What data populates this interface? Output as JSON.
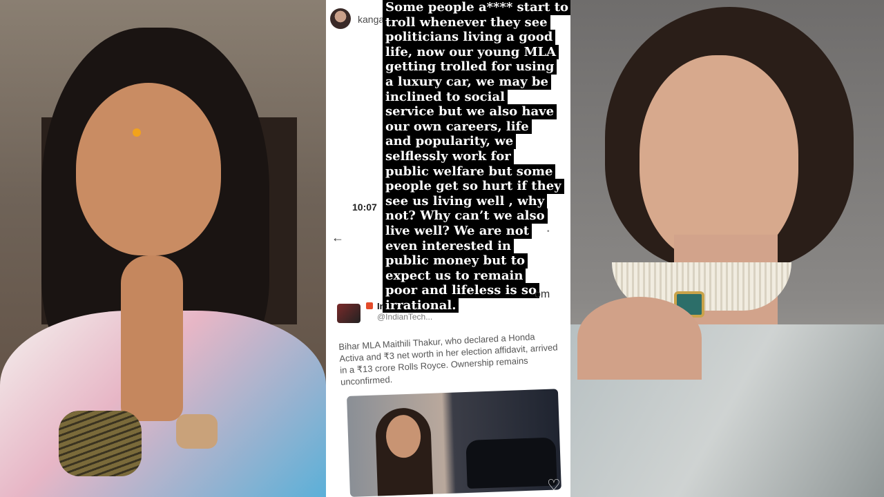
{
  "story": {
    "username": "kanganaranaut",
    "time": "10:07",
    "overlay_lines": [
      "Some people a**** start to",
      "troll whenever they see",
      "politicians living a good",
      "life, now our young MLA",
      "getting trolled for using",
      "a luxury car, we may be",
      "inclined to social",
      "service but we also have",
      "our own careers, life",
      "and popularity, we",
      "selflessly work for",
      "public welfare but some",
      "people get so hurt if they",
      "see us living well , why",
      "not? Why can’t we also",
      "live well? We are not",
      "even interested in",
      "public money but to",
      "expect us to remain",
      "poor  and lifeless is so",
      "irrational."
    ],
    "tweet": {
      "name": "In",
      "handle": "@IndianTech...",
      "trailing_fragment": "om",
      "text": "Bihar MLA Maithili Thakur, who declared a Honda Activa and ₹3 net worth in her election affidavit, arrived in a ₹13 crore Rolls Royce. Ownership remains unconfirmed."
    }
  },
  "icons": {
    "verified": "verified-badge-icon",
    "menu": "more-options-icon",
    "back": "back-arrow-icon",
    "like": "heart-icon"
  },
  "colors": {
    "overlay_bg": "#000000",
    "overlay_text": "#ffffff",
    "verified": "#3b8cf0"
  }
}
